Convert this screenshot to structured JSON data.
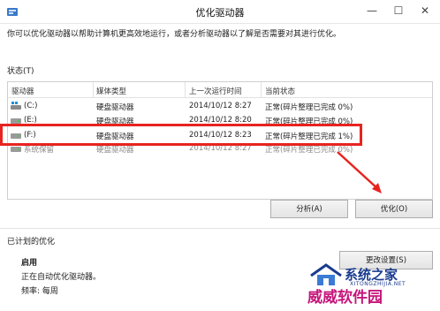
{
  "window": {
    "title": "优化驱动器",
    "minimize_glyph": "—",
    "maximize_glyph": "☐",
    "close_glyph": "✕"
  },
  "intro_text": "你可以优化驱动器以帮助计算机更高效地运行，或者分析驱动器以了解是否需要对其进行优化。",
  "status": {
    "label": "状态(T)",
    "columns": [
      "驱动器",
      "媒体类型",
      "上一次运行时间",
      "当前状态"
    ],
    "rows": [
      {
        "drive": "(C:)",
        "media": "硬盘驱动器",
        "last_run": "2014/10/12 8:27",
        "status": "正常(碎片整理已完成 0%)",
        "icon": "system-drive-icon"
      },
      {
        "drive": "(E:)",
        "media": "硬盘驱动器",
        "last_run": "2014/10/12 8:20",
        "status": "正常(碎片整理已完成 0%)",
        "icon": "drive-icon"
      },
      {
        "drive": "(F:)",
        "media": "硬盘驱动器",
        "last_run": "2014/10/12 8:23",
        "status": "正常(碎片整理已完成 1%)",
        "icon": "drive-icon"
      },
      {
        "drive": "系统保留",
        "media": "硬盘驱动器",
        "last_run": "2014/10/12 8:27",
        "status": "正常(碎片整理已完成 0%)",
        "icon": "drive-icon"
      }
    ]
  },
  "buttons": {
    "analyze": "分析(A)",
    "optimize": "优化(O)",
    "change_settings": "更改设置(S)"
  },
  "schedule": {
    "title": "已计划的优化",
    "state": "启用",
    "status_text": "正在自动优化驱动器。",
    "frequency": "频率: 每周"
  },
  "watermark": {
    "top": "系统之家",
    "url": "XITONGZHIJIA.NET",
    "bottom": "威威软件园"
  },
  "colors": {
    "highlight": "#e8231f",
    "arrow": "#e8231f"
  }
}
